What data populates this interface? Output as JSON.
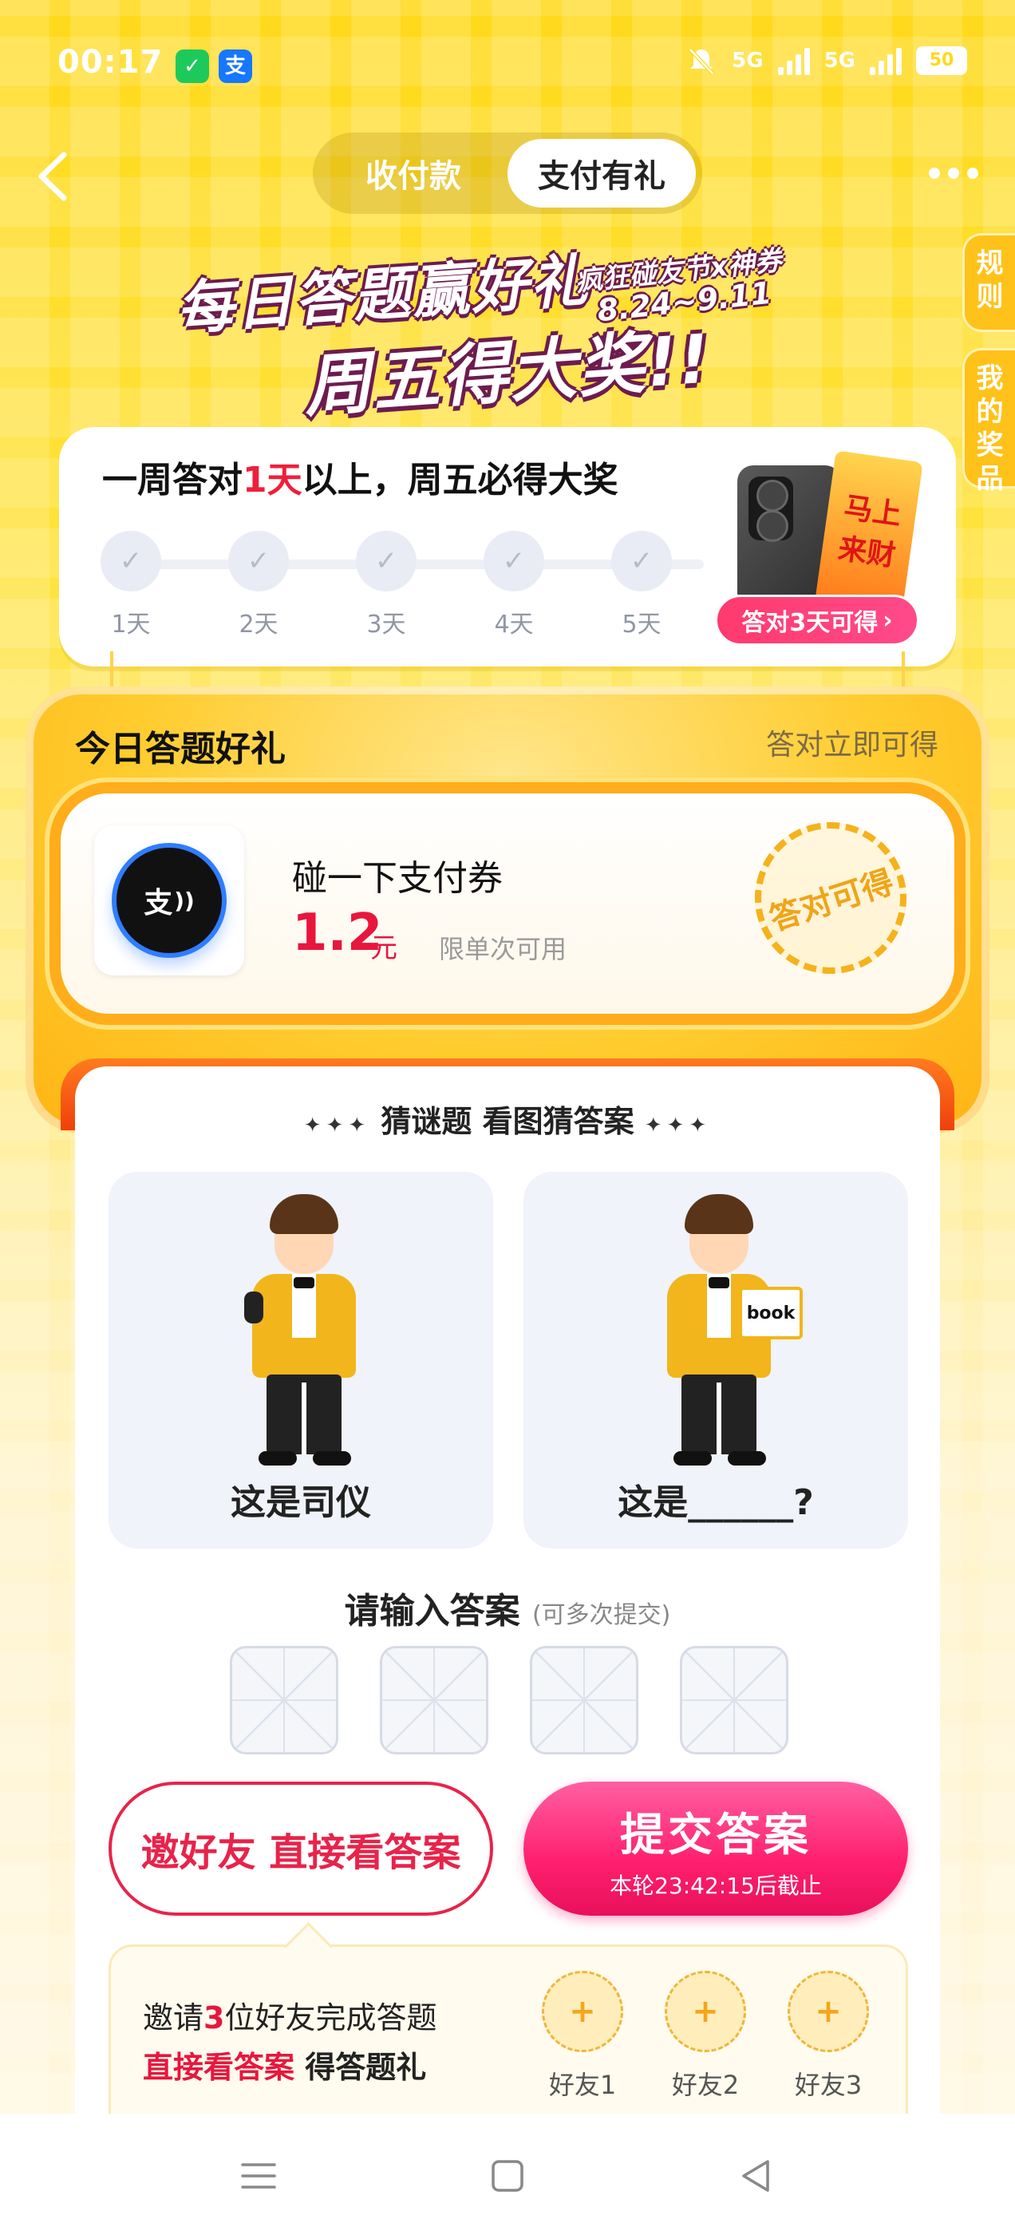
{
  "status_bar": {
    "time": "00:17",
    "wechat_badge": "✓",
    "alipay_badge": "支",
    "network_1": "5G",
    "network_2": "5G",
    "battery": "50"
  },
  "header": {
    "tabs": [
      {
        "label": "收付款",
        "active": false
      },
      {
        "label": "支付有礼",
        "active": true
      }
    ],
    "back_icon": "chevron-left-icon",
    "more_icon": "ellipsis-icon"
  },
  "side_tabs": {
    "rules": "规则",
    "prizes": "我的奖品"
  },
  "banner": {
    "line1": "每日答题赢好礼",
    "event": "疯狂碰友节x神券",
    "dates": "8.24~9.11",
    "line2": "周五得大奖!!"
  },
  "week": {
    "title_pre": "一周答对",
    "title_highlight": "1天",
    "title_post": "以上，周五必得大奖",
    "days": [
      {
        "label": "1天",
        "done": true
      },
      {
        "label": "2天",
        "done": true
      },
      {
        "label": "3天",
        "done": true
      },
      {
        "label": "4天",
        "done": true
      },
      {
        "label": "5天",
        "done": true
      }
    ],
    "prize_card_text": "马上来财",
    "prize_cta": "答对3天可得"
  },
  "gift": {
    "title": "今日答题好礼",
    "subtitle": "答对立即可得",
    "coupon": {
      "icon_text": "支",
      "name": "碰一下支付券",
      "amount": "1.2",
      "unit": "元",
      "limit": "限单次可用",
      "stamp": "答对可得"
    }
  },
  "quiz": {
    "heading": "猜谜题 看图猜答案",
    "heading_deco": "✦✦✦",
    "left_caption": "这是司仪",
    "right_caption": "这是______?",
    "book_text": "book",
    "answer_title": "请输入答案",
    "answer_hint": "(可多次提交)",
    "invite_button": "邀好友 直接看答案",
    "submit_button": "提交答案",
    "submit_sub": "本轮23:42:15后截止",
    "invite_pre": "邀请",
    "invite_count": "3",
    "invite_post": "位好友完成答题",
    "invite_line2_hl": "直接看答案",
    "invite_line2_post": " 得答题礼",
    "friends": [
      {
        "slot": "+",
        "label": "好友1"
      },
      {
        "slot": "+",
        "label": "好友2"
      },
      {
        "slot": "+",
        "label": "好友3"
      }
    ]
  },
  "colors": {
    "brand_yellow": "#ffd91a",
    "accent_red": "#e8163d",
    "submit_pink": "#ff1f6e",
    "alipay_blue": "#1677ff",
    "wechat_green": "#1ec95b"
  }
}
